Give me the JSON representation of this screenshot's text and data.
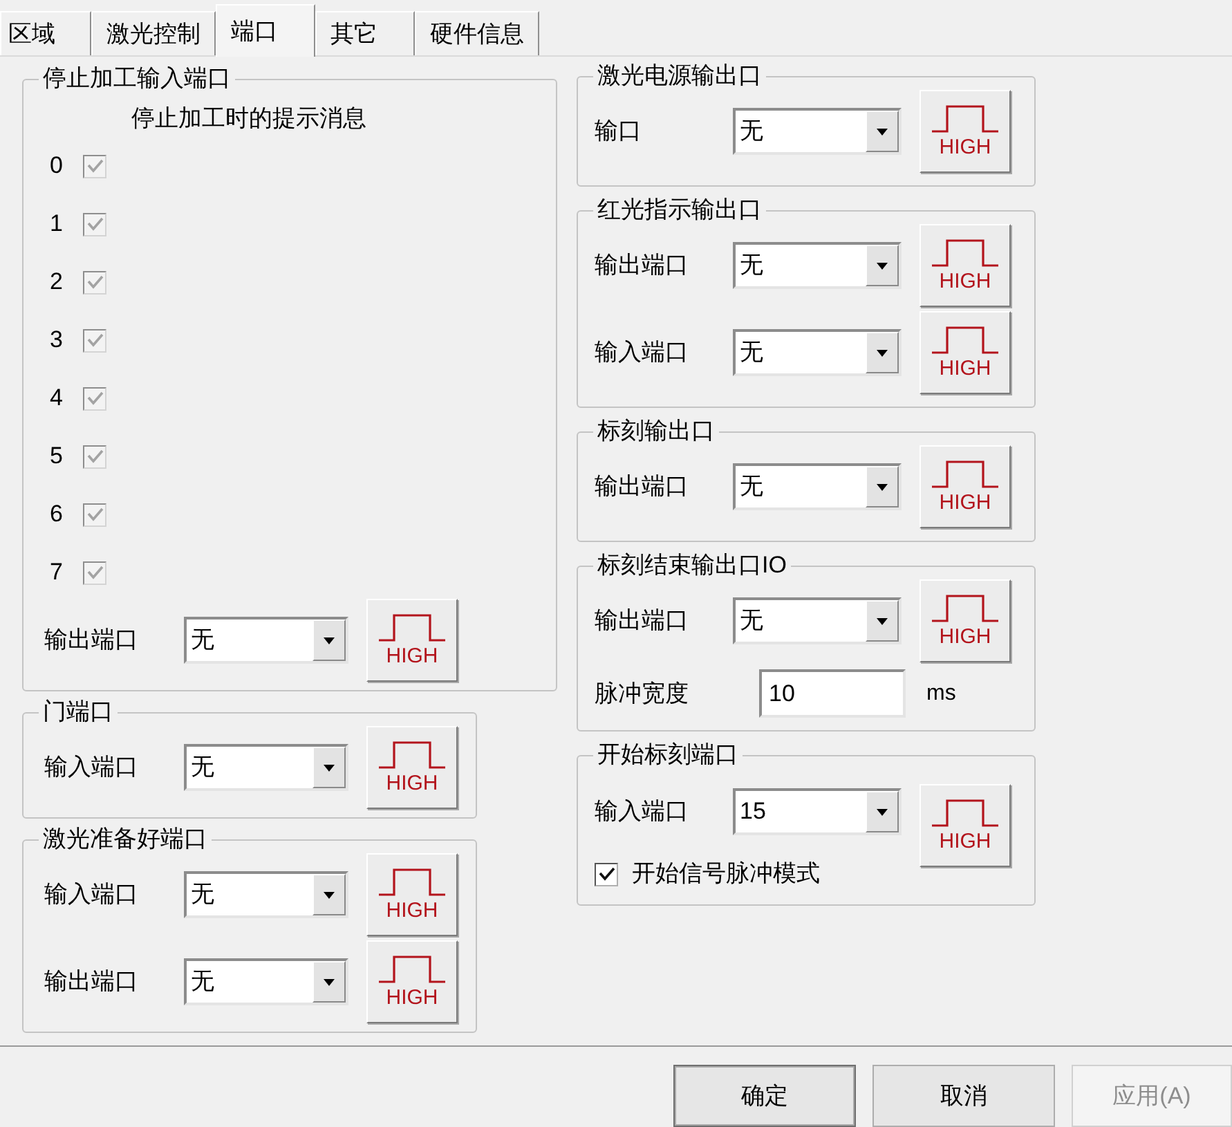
{
  "tabs": [
    {
      "label": "区域",
      "selected": false
    },
    {
      "label": "激光控制",
      "selected": false
    },
    {
      "label": "端口",
      "selected": true
    },
    {
      "label": "其它",
      "selected": false
    },
    {
      "label": "硬件信息",
      "selected": false
    }
  ],
  "left_column": [
    {
      "title": "停止加工输入端口",
      "subtitle": "停止加工时的提示消息",
      "bits": [
        {
          "label": "0",
          "checked": true,
          "disabled": true
        },
        {
          "label": "1",
          "checked": true,
          "disabled": true
        },
        {
          "label": "2",
          "checked": true,
          "disabled": true
        },
        {
          "label": "3",
          "checked": true,
          "disabled": true
        },
        {
          "label": "4",
          "checked": true,
          "disabled": true
        },
        {
          "label": "5",
          "checked": true,
          "disabled": true
        },
        {
          "label": "6",
          "checked": true,
          "disabled": true
        },
        {
          "label": "7",
          "checked": true,
          "disabled": true
        }
      ],
      "rows": [
        {
          "kind": "dropdown",
          "label": "输出端口",
          "value": "无",
          "signal_button": "HIGH"
        }
      ]
    },
    {
      "title": "门端口",
      "rows": [
        {
          "kind": "dropdown",
          "label": "输入端口",
          "value": "无",
          "signal_button": "HIGH"
        }
      ]
    },
    {
      "title": "激光准备好端口",
      "rows": [
        {
          "kind": "dropdown",
          "label": "输入端口",
          "value": "无",
          "signal_button": "HIGH"
        },
        {
          "kind": "dropdown",
          "label": "输出端口",
          "value": "无",
          "signal_button": "HIGH"
        }
      ]
    }
  ],
  "right_column": [
    {
      "title": "激光电源输出口",
      "rows": [
        {
          "kind": "dropdown",
          "label": "输口",
          "value": "无",
          "signal_button": "HIGH"
        }
      ]
    },
    {
      "title": "红光指示输出口",
      "rows": [
        {
          "kind": "dropdown",
          "label": "输出端口",
          "value": "无",
          "signal_button": "HIGH"
        },
        {
          "kind": "dropdown",
          "label": "输入端口",
          "value": "无",
          "signal_button": "HIGH"
        }
      ]
    },
    {
      "title": "标刻输出口",
      "rows": [
        {
          "kind": "dropdown",
          "label": "输出端口",
          "value": "无",
          "signal_button": "HIGH"
        }
      ]
    },
    {
      "title": "标刻结束输出口IO",
      "rows": [
        {
          "kind": "dropdown",
          "label": "输出端口",
          "value": "无",
          "signal_button": "HIGH"
        },
        {
          "kind": "number",
          "label": "脉冲宽度",
          "value": "10",
          "unit": "ms"
        }
      ]
    },
    {
      "title": "开始标刻端口",
      "rows": [
        {
          "kind": "dropdown",
          "label": "输入端口",
          "value": "15",
          "signal_button": "HIGH"
        },
        {
          "kind": "checkbox",
          "label": "开始信号脉冲模式",
          "checked": true
        }
      ]
    }
  ],
  "buttons": [
    {
      "label": "确定",
      "default": true,
      "disabled": false
    },
    {
      "label": "取消",
      "default": false,
      "disabled": false
    },
    {
      "label": "应用(A)",
      "default": false,
      "disabled": true
    }
  ]
}
